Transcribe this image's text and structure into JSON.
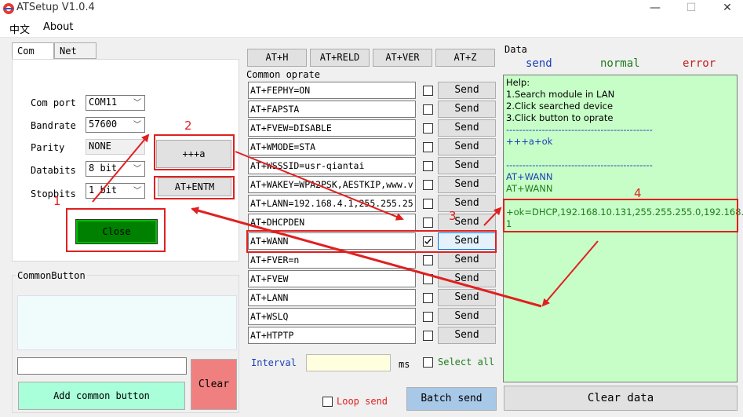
{
  "window": {
    "title": "ATSetup V1.0.4",
    "minimize": "—",
    "maximize": "☐",
    "close": "✕"
  },
  "menu": {
    "items": [
      "中文",
      "About"
    ]
  },
  "tabs": [
    "Com",
    "Net"
  ],
  "com": {
    "fields": [
      {
        "label": "Com port",
        "value": "COM11"
      },
      {
        "label": "Bandrate",
        "value": "57600"
      },
      {
        "label": "Parity",
        "value": "NONE"
      },
      {
        "label": "Databits",
        "value": "8 bit"
      },
      {
        "label": "Stopbits",
        "value": "1 bit"
      }
    ],
    "plus_button": "+++a",
    "entm_button": "AT+ENTM",
    "close_button": "Close"
  },
  "common_button": {
    "title": "CommonButton",
    "add_label": "Add common button",
    "clear_label": "Clear",
    "input_value": ""
  },
  "top_buttons": [
    "AT+H",
    "AT+RELD",
    "AT+VER",
    "AT+Z"
  ],
  "commands": {
    "title": "Common oprate",
    "send_label": "Send",
    "rows": [
      {
        "cmd": "AT+FEPHY=ON",
        "checked": false
      },
      {
        "cmd": "AT+FAPSTA",
        "checked": false
      },
      {
        "cmd": "AT+FVEW=DISABLE",
        "checked": false
      },
      {
        "cmd": "AT+WMODE=STA",
        "checked": false
      },
      {
        "cmd": "AT+WSSSID=usr-qiantai",
        "checked": false
      },
      {
        "cmd": "AT+WAKEY=WPA2PSK,AESTKIP,www.v",
        "checked": false
      },
      {
        "cmd": "AT+LANN=192.168.4.1,255.255.25",
        "checked": false
      },
      {
        "cmd": "AT+DHCPDEN",
        "checked": false
      },
      {
        "cmd": "AT+WANN",
        "checked": true
      },
      {
        "cmd": "AT+FVER=n",
        "checked": false
      },
      {
        "cmd": "AT+FVEW",
        "checked": false
      },
      {
        "cmd": "AT+LANN",
        "checked": false
      },
      {
        "cmd": "AT+WSLQ",
        "checked": false
      },
      {
        "cmd": "AT+HTPTP",
        "checked": false
      }
    ],
    "interval_label": "Interval",
    "interval_value": "",
    "ms_label": "ms",
    "select_all_label": "Select all",
    "loop_send_label": "Loop send",
    "batch_send_label": "Batch send"
  },
  "data": {
    "title": "Data",
    "legend": [
      "send",
      "normal",
      "error"
    ],
    "legend_colors": [
      "#1a3fb8",
      "#1e7d1e",
      "#c41e1e"
    ],
    "lines": [
      {
        "text": "Help:",
        "color": "#000000"
      },
      {
        "text": "1.Search module in LAN",
        "color": "#000000"
      },
      {
        "text": "2.Click searched device",
        "color": "#000000"
      },
      {
        "text": "3.Click button to oprate",
        "color": "#000000"
      },
      {
        "text": "---------------------------------------------",
        "color": "#1a3fb8"
      },
      {
        "text": "+++a+ok",
        "color": "#1a3fb8"
      },
      {
        "text": "",
        "color": "#000000"
      },
      {
        "text": "---------------------------------------------",
        "color": "#1a3fb8"
      },
      {
        "text": "AT+WANN",
        "color": "#1a3fb8"
      },
      {
        "text": "AT+WANN",
        "color": "#1e7d1e"
      },
      {
        "text": "",
        "color": "#000000"
      },
      {
        "text": "+ok=DHCP,192.168.10.131,255.255.255.0,192.168.10.",
        "color": "#1e7d1e"
      },
      {
        "text": "1",
        "color": "#1e7d1e"
      }
    ],
    "clear_label": "Clear data"
  },
  "annotations": [
    "1",
    "2",
    "3",
    "4"
  ],
  "colors": {
    "close_bg": "#008000",
    "add_btn_bg": "#a8ffd9",
    "clear_btn_bg": "#f08080",
    "annotation": "#e02020",
    "data_bg": "#c7fec7"
  }
}
